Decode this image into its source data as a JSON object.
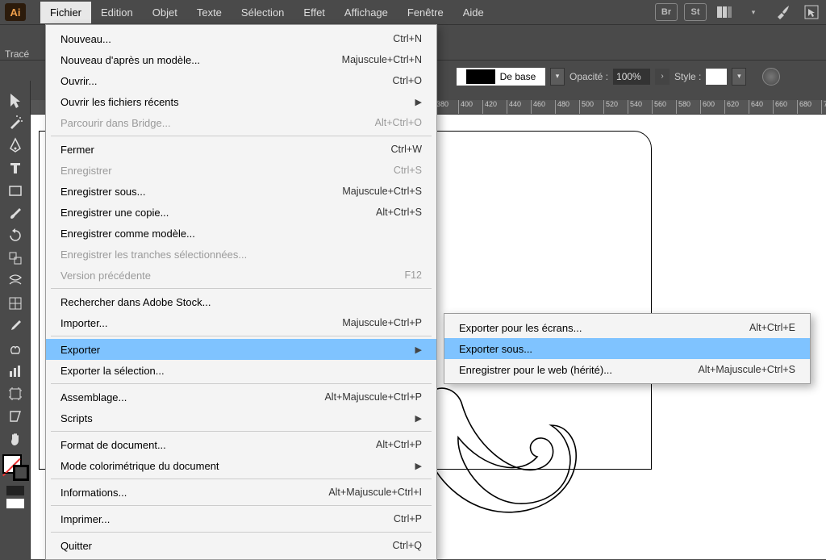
{
  "app": {
    "logo": "Ai"
  },
  "menubar": {
    "items": [
      "Fichier",
      "Edition",
      "Objet",
      "Texte",
      "Sélection",
      "Effet",
      "Affichage",
      "Fenêtre",
      "Aide"
    ],
    "right_icons": [
      "Br",
      "St",
      "layout-icon",
      "caret",
      "rocket-icon",
      "pointer-panel-icon"
    ]
  },
  "optionsbar": {
    "left_label": "Tracé",
    "stroke_label": "De base",
    "opacity_label": "Opacité :",
    "opacity_value": "100%",
    "style_label": "Style :"
  },
  "ruler": {
    "start": 60,
    "step": 20,
    "count": 34
  },
  "file_menu": {
    "sections": [
      [
        {
          "label": "Nouveau...",
          "shortcut": "Ctrl+N"
        },
        {
          "label": "Nouveau d'après un modèle...",
          "shortcut": "Majuscule+Ctrl+N"
        },
        {
          "label": "Ouvrir...",
          "shortcut": "Ctrl+O"
        },
        {
          "label": "Ouvrir les fichiers récents",
          "arrow": true
        },
        {
          "label": "Parcourir dans Bridge...",
          "shortcut": "Alt+Ctrl+O",
          "disabled": true
        }
      ],
      [
        {
          "label": "Fermer",
          "shortcut": "Ctrl+W"
        },
        {
          "label": "Enregistrer",
          "shortcut": "Ctrl+S",
          "disabled": true
        },
        {
          "label": "Enregistrer sous...",
          "shortcut": "Majuscule+Ctrl+S"
        },
        {
          "label": "Enregistrer une copie...",
          "shortcut": "Alt+Ctrl+S"
        },
        {
          "label": "Enregistrer comme modèle..."
        },
        {
          "label": "Enregistrer les tranches sélectionnées...",
          "disabled": true
        },
        {
          "label": "Version précédente",
          "shortcut": "F12",
          "disabled": true
        }
      ],
      [
        {
          "label": "Rechercher dans Adobe Stock..."
        },
        {
          "label": "Importer...",
          "shortcut": "Majuscule+Ctrl+P"
        }
      ],
      [
        {
          "label": "Exporter",
          "arrow": true,
          "highlight": true
        },
        {
          "label": "Exporter la sélection..."
        }
      ],
      [
        {
          "label": "Assemblage...",
          "shortcut": "Alt+Majuscule+Ctrl+P"
        },
        {
          "label": "Scripts",
          "arrow": true
        }
      ],
      [
        {
          "label": "Format de document...",
          "shortcut": "Alt+Ctrl+P"
        },
        {
          "label": "Mode colorimétrique du document",
          "arrow": true
        }
      ],
      [
        {
          "label": "Informations...",
          "shortcut": "Alt+Majuscule+Ctrl+I"
        }
      ],
      [
        {
          "label": "Imprimer...",
          "shortcut": "Ctrl+P"
        }
      ],
      [
        {
          "label": "Quitter",
          "shortcut": "Ctrl+Q"
        }
      ]
    ]
  },
  "export_submenu": [
    {
      "label": "Exporter pour les écrans...",
      "shortcut": "Alt+Ctrl+E"
    },
    {
      "label": "Exporter sous...",
      "highlight": true
    },
    {
      "label": "Enregistrer pour le web (hérité)...",
      "shortcut": "Alt+Majuscule+Ctrl+S"
    }
  ],
  "tools": [
    "selection",
    "magic-wand",
    "pen",
    "type",
    "rectangle",
    "brush",
    "rotate",
    "scale",
    "warp",
    "mesh",
    "eyedropper",
    "symbol",
    "graph",
    "artboard",
    "slice",
    "hand"
  ]
}
